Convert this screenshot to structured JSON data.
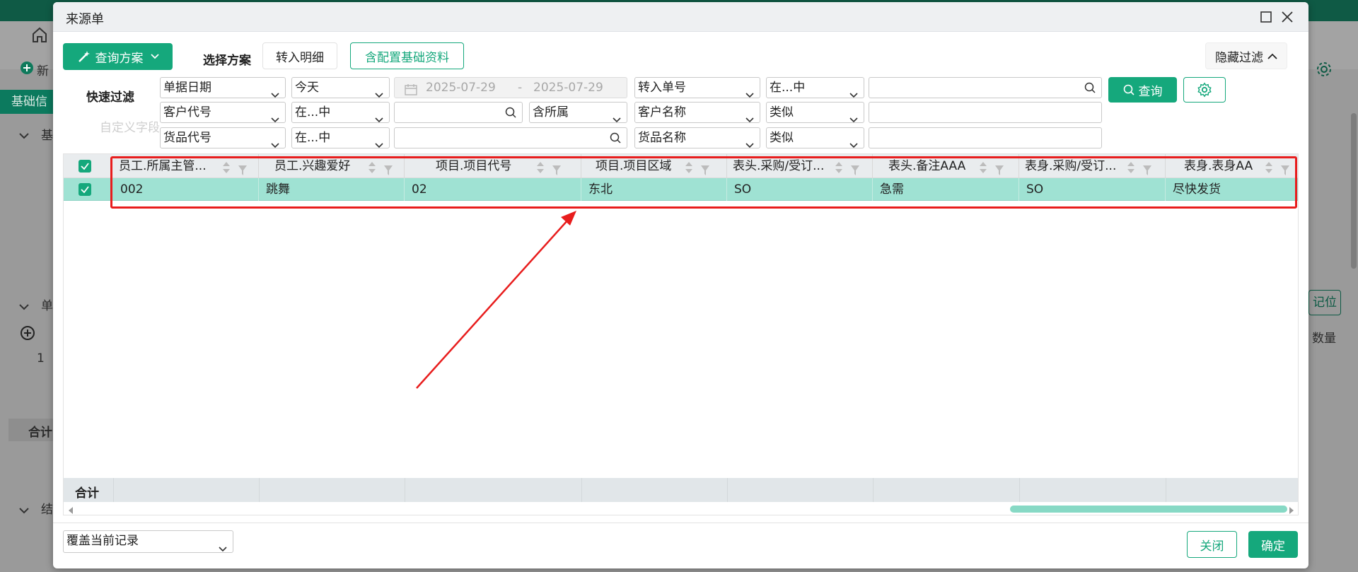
{
  "background": {
    "new_label": "新",
    "tag_label": "基础信",
    "section1": "基",
    "section2": "单",
    "row_num": "1",
    "sum_label": "合计",
    "section3": "结",
    "right_btn": "记位",
    "right_col": "数量"
  },
  "modal": {
    "title": "来源单"
  },
  "toolbar": {
    "query_scheme": "查询方案",
    "choose_scheme": "选择方案",
    "transfer_detail": "转入明细",
    "with_config": "含配置基础资料",
    "hide_filter": "隐藏过滤"
  },
  "filter": {
    "quick_filter": "快速过滤",
    "custom_field": "自定义字段",
    "row1": {
      "field": "单据日期",
      "op": "今天",
      "date_from": "2025-07-29",
      "date_sep": "-",
      "date_to": "2025-07-29",
      "field2": "转入单号",
      "op2": "在...中",
      "value2": ""
    },
    "row2": {
      "field": "客户代号",
      "op": "在...中",
      "value": "",
      "extra": "含所属",
      "field2": "客户名称",
      "op2": "类似",
      "value2": ""
    },
    "row3": {
      "field": "货品代号",
      "op": "在...中",
      "value": "",
      "field2": "货品名称",
      "op2": "类似",
      "value2": ""
    },
    "query_btn": "查询"
  },
  "grid": {
    "columns": [
      "员工.所属主管...",
      "员工.兴趣爱好",
      "项目.项目代号",
      "项目.项目区域",
      "表头.采购/受订...",
      "表头.备注AAA",
      "表身.采购/受订...",
      "表身.表身AA"
    ],
    "rows": [
      [
        "002",
        "跳舞",
        "02",
        "东北",
        "SO",
        "急需",
        "SO",
        "尽快发货"
      ]
    ],
    "sum_label": "合计"
  },
  "footer": {
    "mode": "覆盖当前记录",
    "close": "关闭",
    "confirm": "确定"
  },
  "colors": {
    "accent": "#15a87c",
    "selected_row": "#9fe2d3",
    "highlight": "#e81d1d"
  }
}
